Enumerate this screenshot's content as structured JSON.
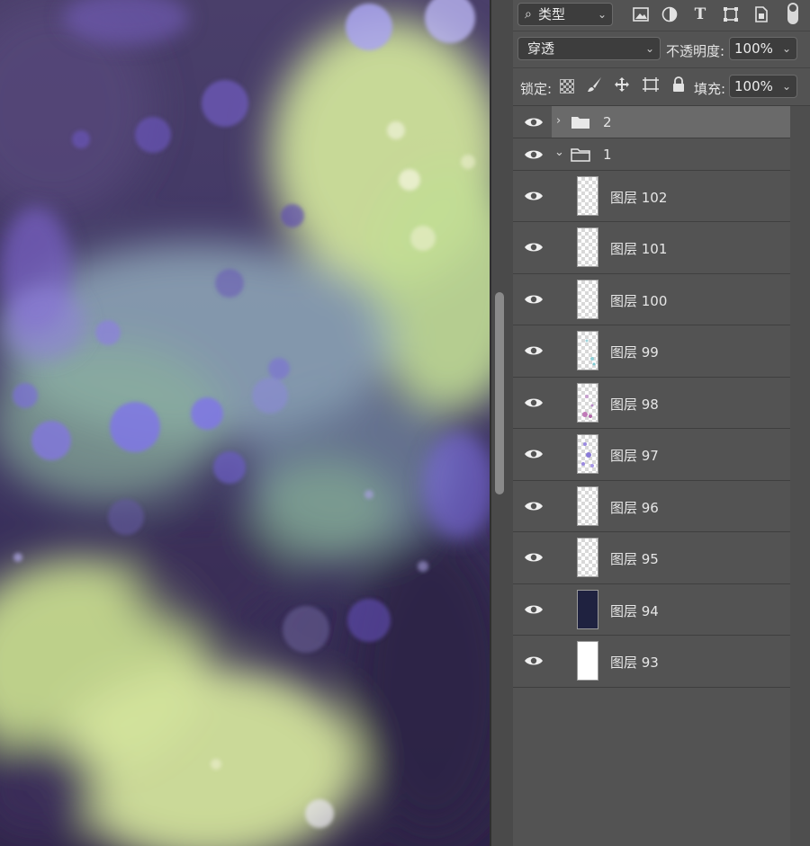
{
  "filter_bar": {
    "kind_label": "类型",
    "kind_icon": "search-icon"
  },
  "blend": {
    "mode": "穿透",
    "opacity_label": "不透明度:",
    "opacity_value": "100%"
  },
  "lock": {
    "label": "锁定:",
    "fill_label": "填充:",
    "fill_value": "100%"
  },
  "groups": [
    {
      "name": "2",
      "expanded": false,
      "selected": true
    },
    {
      "name": "1",
      "expanded": true,
      "selected": false
    }
  ],
  "layers": [
    {
      "name": "图层 102",
      "thumb": "transparent"
    },
    {
      "name": "图层 101",
      "thumb": "transparent"
    },
    {
      "name": "图层 100",
      "thumb": "transparent"
    },
    {
      "name": "图层 99",
      "thumb": "transparent-teal-specks"
    },
    {
      "name": "图层 98",
      "thumb": "transparent-pink-specks"
    },
    {
      "name": "图层 97",
      "thumb": "transparent-purple-specks"
    },
    {
      "name": "图层 96",
      "thumb": "transparent"
    },
    {
      "name": "图层 95",
      "thumb": "transparent"
    },
    {
      "name": "图层 94",
      "thumb": "dark-navy"
    },
    {
      "name": "图层 93",
      "thumb": "white"
    }
  ],
  "colors": {
    "panel_bg": "#535353",
    "selected_row": "#6a6a6a",
    "field_bg": "#3d3d3d"
  }
}
